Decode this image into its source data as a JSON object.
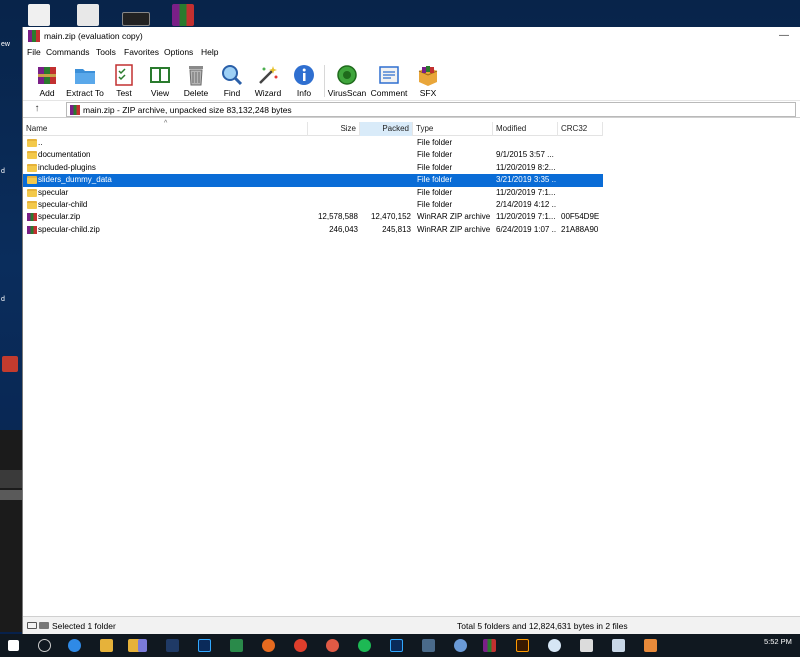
{
  "window": {
    "title": "main.zip (evaluation copy)",
    "minimize_glyph": "—"
  },
  "menu": [
    "File",
    "Commands",
    "Tools",
    "Favorites",
    "Options",
    "Help"
  ],
  "toolbar": {
    "buttons": [
      {
        "label": "Add",
        "icon": "add-archive-icon"
      },
      {
        "label": "Extract To",
        "icon": "extract-folder-icon"
      },
      {
        "label": "Test",
        "icon": "test-checklist-icon"
      },
      {
        "label": "View",
        "icon": "view-book-icon"
      },
      {
        "label": "Delete",
        "icon": "trash-icon"
      },
      {
        "label": "Find",
        "icon": "magnifier-icon"
      },
      {
        "label": "Wizard",
        "icon": "wand-icon"
      },
      {
        "label": "Info",
        "icon": "info-icon"
      },
      {
        "label": "VirusScan",
        "icon": "virus-scan-icon"
      },
      {
        "label": "Comment",
        "icon": "comment-icon"
      },
      {
        "label": "SFX",
        "icon": "sfx-box-icon"
      }
    ]
  },
  "address": {
    "up_glyph": "↑",
    "text": "main.zip - ZIP archive, unpacked size 83,132,248 bytes"
  },
  "columns": {
    "name": "Name",
    "size": "Size",
    "packed": "Packed",
    "type": "Type",
    "modified": "Modified",
    "crc": "CRC32"
  },
  "rows": [
    {
      "name": "..",
      "size": "",
      "packed": "",
      "type": "File folder",
      "modified": "",
      "crc": "",
      "kind": "folder",
      "selected": false
    },
    {
      "name": "documentation",
      "size": "",
      "packed": "",
      "type": "File folder",
      "modified": "9/1/2015 3:57 ...",
      "crc": "",
      "kind": "folder",
      "selected": false
    },
    {
      "name": "included-plugins",
      "size": "",
      "packed": "",
      "type": "File folder",
      "modified": "11/20/2019 8:2...",
      "crc": "",
      "kind": "folder",
      "selected": false
    },
    {
      "name": "sliders_dummy_data",
      "size": "",
      "packed": "",
      "type": "File folder",
      "modified": "3/21/2019 3:35 ...",
      "crc": "",
      "kind": "folder",
      "selected": true
    },
    {
      "name": "specular",
      "size": "",
      "packed": "",
      "type": "File folder",
      "modified": "11/20/2019 7:1...",
      "crc": "",
      "kind": "folder",
      "selected": false
    },
    {
      "name": "specular-child",
      "size": "",
      "packed": "",
      "type": "File folder",
      "modified": "2/14/2019 4:12 ...",
      "crc": "",
      "kind": "folder",
      "selected": false
    },
    {
      "name": "specular.zip",
      "size": "12,578,588",
      "packed": "12,470,152",
      "type": "WinRAR ZIP archive",
      "modified": "11/20/2019 7:1...",
      "crc": "00F54D9E",
      "kind": "zip",
      "selected": false
    },
    {
      "name": "specular-child.zip",
      "size": "246,043",
      "packed": "245,813",
      "type": "WinRAR ZIP archive",
      "modified": "6/24/2019 1:07 ...",
      "crc": "21A88A90",
      "kind": "zip",
      "selected": false
    }
  ],
  "status": {
    "left": "Selected 1 folder",
    "right": "Total 5 folders and 12,824,631 bytes in 2 files"
  },
  "desktop": {
    "side_labels": [
      "ew",
      "d",
      "d"
    ]
  },
  "taskbar": {
    "clock": "5:52 PM"
  }
}
